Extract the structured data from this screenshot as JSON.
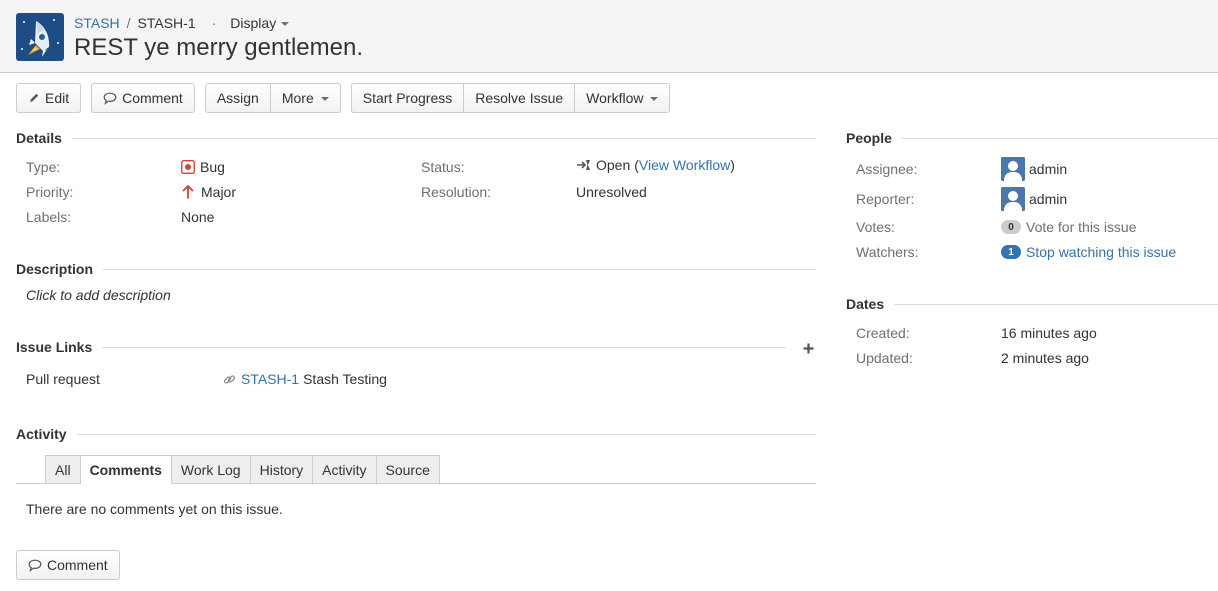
{
  "header": {
    "project": "STASH",
    "breadcrumb_sep": "/",
    "issue_key": "STASH-1",
    "dot": "·",
    "display_label": "Display",
    "summary": "REST ye merry gentlemen."
  },
  "toolbar": {
    "edit": "Edit",
    "comment": "Comment",
    "assign": "Assign",
    "more": "More",
    "start_progress": "Start Progress",
    "resolve_issue": "Resolve Issue",
    "workflow": "Workflow"
  },
  "details": {
    "heading": "Details",
    "type_label": "Type:",
    "type_value": "Bug",
    "priority_label": "Priority:",
    "priority_value": "Major",
    "labels_label": "Labels:",
    "labels_value": "None",
    "status_label": "Status:",
    "status_value": "Open",
    "view_workflow_open": "(",
    "view_workflow": "View Workflow",
    "view_workflow_close": ")",
    "resolution_label": "Resolution:",
    "resolution_value": "Unresolved"
  },
  "description": {
    "heading": "Description",
    "placeholder": "Click to add description"
  },
  "issue_links": {
    "heading": "Issue Links",
    "link_type": "Pull request",
    "link_key": "STASH-1",
    "link_title": "Stash Testing"
  },
  "activity": {
    "heading": "Activity",
    "tabs": [
      "All",
      "Comments",
      "Work Log",
      "History",
      "Activity",
      "Source"
    ],
    "active_tab": "Comments",
    "empty_message": "There are no comments yet on this issue.",
    "comment_button": "Comment"
  },
  "people": {
    "heading": "People",
    "assignee_label": "Assignee:",
    "assignee_value": "admin",
    "reporter_label": "Reporter:",
    "reporter_value": "admin",
    "votes_label": "Votes:",
    "votes_count": "0",
    "vote_link": "Vote for this issue",
    "watchers_label": "Watchers:",
    "watchers_count": "1",
    "watch_link": "Stop watching this issue"
  },
  "dates": {
    "heading": "Dates",
    "created_label": "Created:",
    "created_value": "16 minutes ago",
    "updated_label": "Updated:",
    "updated_value": "2 minutes ago"
  },
  "icons": {
    "project": "rocket-icon",
    "edit": "pencil-icon",
    "comment": "speech-bubble-icon",
    "bug": "bug-icon",
    "priority": "arrow-up-icon",
    "status": "status-open-icon",
    "link": "chain-link-icon",
    "add": "plus-icon"
  },
  "colors": {
    "link": "#3572b0",
    "bug": "#d04437",
    "priority_major": "#d04437",
    "header_bg": "#f5f5f5"
  }
}
